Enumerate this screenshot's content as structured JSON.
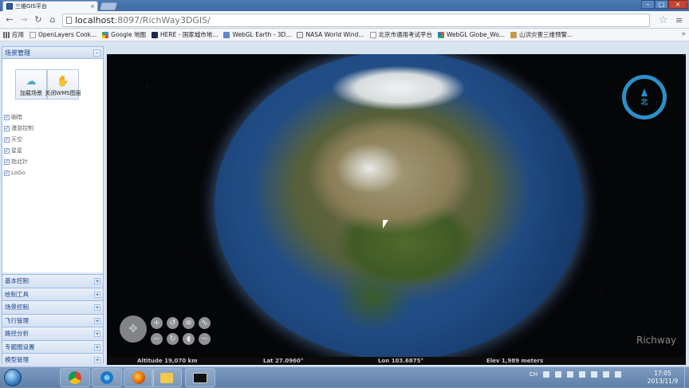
{
  "browser": {
    "tab_title": "三维GIS平台",
    "tab_close": "×",
    "url_host": "localhost",
    "url_path": ":8097/RichWay3DGIS/",
    "nav": {
      "back": "←",
      "forward": "→",
      "reload": "↻",
      "home": "⌂"
    },
    "star": "☆",
    "menu": "≡",
    "window": {
      "minimize": "–",
      "maximize": "□",
      "close": "×"
    }
  },
  "bookmarks": [
    {
      "label": "应用",
      "icon": "apps-icon"
    },
    {
      "label": "OpenLayers Cook...",
      "icon": "page-icon"
    },
    {
      "label": "Google 地图",
      "icon": "google-icon"
    },
    {
      "label": "HERE - 国家城市地...",
      "icon": "here-icon"
    },
    {
      "label": "WebGL Earth - 3D...",
      "icon": "globe-icon"
    },
    {
      "label": "NASA World Wind...",
      "icon": "nasa-icon"
    },
    {
      "label": "北京市通用考试平台",
      "icon": "page-icon"
    },
    {
      "label": "WebGL Globe_Wo...",
      "icon": "webgl-icon"
    },
    {
      "label": "山洪灾害三维预警...",
      "icon": "flood-icon"
    }
  ],
  "bookmarks_more": "»",
  "panel": {
    "title": "场景管理",
    "collapse": "–",
    "tools": [
      {
        "label": "加载场景",
        "icon": "cloud-icon",
        "glyph": "☁"
      },
      {
        "label": "关闭WMS图层",
        "icon": "hand-icon",
        "glyph": "✋"
      }
    ],
    "layers": [
      {
        "label": "幽暗",
        "checked": "✓"
      },
      {
        "label": "漫游控制",
        "checked": "✓"
      },
      {
        "label": "天空",
        "checked": "✓"
      },
      {
        "label": "星星",
        "checked": "✓"
      },
      {
        "label": "指北针",
        "checked": "✓"
      },
      {
        "label": "LoGo",
        "checked": "✓"
      }
    ],
    "sections": [
      {
        "label": "基本控制",
        "plus": "+"
      },
      {
        "label": "绘制工具",
        "plus": "+"
      },
      {
        "label": "场景控制",
        "plus": "+"
      },
      {
        "label": "飞行管理",
        "plus": "+"
      },
      {
        "label": "路径分析",
        "plus": "+"
      },
      {
        "label": "专题图设置",
        "plus": "+"
      },
      {
        "label": "模型管理",
        "plus": "+"
      }
    ]
  },
  "map": {
    "compass_north": "北",
    "pad_glyph": "✥",
    "controls": [
      {
        "name": "zoom-in-button",
        "glyph": "+"
      },
      {
        "name": "rotate-left-button",
        "glyph": "↺"
      },
      {
        "name": "tilt-up-button",
        "glyph": "≡"
      },
      {
        "name": "tilt-reset-button",
        "glyph": "∿"
      },
      {
        "name": "zoom-out-button",
        "glyph": "−"
      },
      {
        "name": "rotate-right-button",
        "glyph": "↻"
      },
      {
        "name": "tilt-down-button",
        "glyph": "◖"
      },
      {
        "name": "tilt-flat-button",
        "glyph": "~"
      }
    ],
    "watermark": "Richway",
    "status": {
      "altitude": "Altitude  19,070 km",
      "lat": "Lat 27.0960°",
      "lon": "Lon 103.6875°",
      "elev": "Elev   1,989 meters"
    }
  },
  "taskbar": {
    "apps": [
      {
        "name": "taskbar-chrome",
        "icon": "chrome-icon"
      },
      {
        "name": "taskbar-ie",
        "icon": "ie-icon"
      },
      {
        "name": "taskbar-firefox",
        "icon": "firefox-icon"
      },
      {
        "name": "taskbar-explorer",
        "icon": "folder-icon"
      },
      {
        "name": "taskbar-cmd",
        "icon": "cmd-icon"
      }
    ],
    "tray_lang": "CH",
    "time": "17:05",
    "date": "2013/11/9"
  }
}
